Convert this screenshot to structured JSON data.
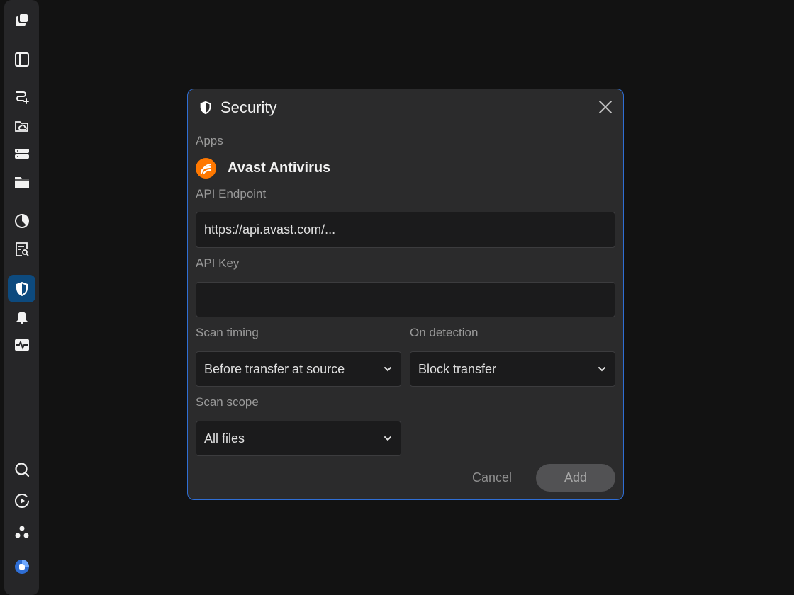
{
  "sidebar": {
    "items": [
      {
        "icon": "stack-logo-icon"
      },
      {
        "icon": "sidebar-panel-icon"
      },
      {
        "icon": "route-add-icon"
      },
      {
        "icon": "cloud-folder-icon"
      },
      {
        "icon": "storage-icon"
      },
      {
        "icon": "folder-icon"
      },
      {
        "icon": "pie-chart-icon"
      },
      {
        "icon": "search-log-icon"
      },
      {
        "icon": "shield-icon",
        "active": true
      },
      {
        "icon": "bell-icon"
      },
      {
        "icon": "activity-icon"
      },
      {
        "icon": "search-icon"
      },
      {
        "icon": "play-circle-icon"
      },
      {
        "icon": "community-icon"
      },
      {
        "icon": "brand-logo-icon"
      }
    ],
    "active_color": "#0d4a7e"
  },
  "dialog": {
    "title": "Security",
    "apps_label": "Apps",
    "app_name": "Avast Antivirus",
    "app_brand_color": "#ff7800",
    "endpoint_label": "API Endpoint",
    "endpoint_value": "https://api.avast.com/...",
    "api_key_label": "API Key",
    "api_key_value": "",
    "scan_timing_label": "Scan timing",
    "scan_timing_value": "Before transfer at source",
    "on_detection_label": "On detection",
    "on_detection_value": "Block transfer",
    "scan_scope_label": "Scan scope",
    "scan_scope_value": "All files",
    "cancel_label": "Cancel",
    "add_label": "Add",
    "border_color": "#2f6ed4"
  }
}
